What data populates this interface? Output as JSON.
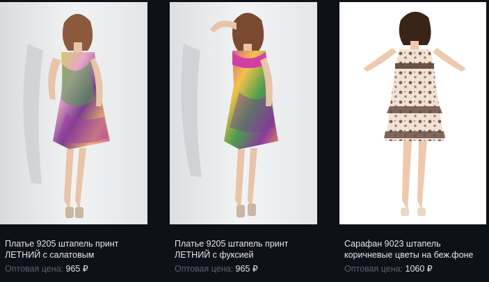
{
  "products": [
    {
      "name": "Платье 9205 штапель принт ЛЕТНИЙ с салатовым",
      "price_label": "Оптовая цена:",
      "price": "965 ₽",
      "photo_icon": "dress-photo-green-print"
    },
    {
      "name": "Платье 9205 штапель принт ЛЕТНИЙ с фуксией",
      "price_label": "Оптовая цена:",
      "price": "965 ₽",
      "photo_icon": "dress-photo-fuchsia-print"
    },
    {
      "name": "Сарафан 9023 штапель коричневые цветы на беж.фоне",
      "price_label": "Оптовая цена:",
      "price": "1060 ₽",
      "photo_icon": "sundress-photo-brown-flowers"
    }
  ],
  "colors": {
    "page_background": "#0d1118",
    "text_primary": "#e6e8ea",
    "text_muted": "#5d636b"
  }
}
